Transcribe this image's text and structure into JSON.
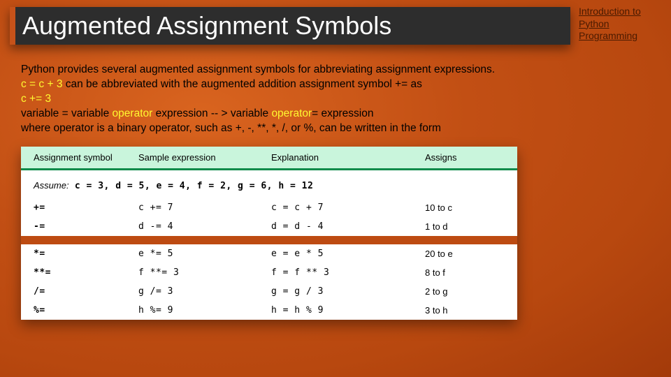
{
  "header": {
    "title": "Augmented Assignment Symbols",
    "subtitle": "Introduction to Python Programming"
  },
  "body": {
    "line1": "Python provides several augmented assignment symbols for abbreviating assignment expressions.",
    "line2a": "c = c + 3",
    "line2b": " can be abbreviated with the augmented addition assignment symbol += as",
    "line3": "c += 3",
    "line4a": "variable = variable ",
    "line4op": "operator",
    "line4b": " expression    -- >   variable ",
    "line4op2": "operator",
    "line4c": "= expression",
    "line5": "where operator is a binary operator, such as +, -, **, *, /, or %, can be written in the form"
  },
  "table": {
    "headers": [
      "Assignment symbol",
      "Sample expression",
      "Explanation",
      "Assigns"
    ],
    "assume_label": "Assume:",
    "assume_code": " c = 3, d = 5, e = 4, f = 2, g = 6, h = 12",
    "group1": [
      {
        "sym": "+=",
        "sample": "c += 7",
        "explain": "c = c + 7",
        "assigns": "10 to c"
      },
      {
        "sym": "-=",
        "sample": "d -= 4",
        "explain": "d = d - 4",
        "assigns": "1 to d"
      }
    ],
    "group2": [
      {
        "sym": "*=",
        "sample": "e *= 5",
        "explain": "e = e * 5",
        "assigns": "20 to e"
      },
      {
        "sym": "**=",
        "sample": "f **= 3",
        "explain": "f = f ** 3",
        "assigns": "8 to f"
      },
      {
        "sym": "/=",
        "sample": "g /= 3",
        "explain": "g = g / 3",
        "assigns": "2 to g"
      },
      {
        "sym": "%=",
        "sample": "h %= 9",
        "explain": "h = h % 9",
        "assigns": "3 to h"
      }
    ]
  }
}
